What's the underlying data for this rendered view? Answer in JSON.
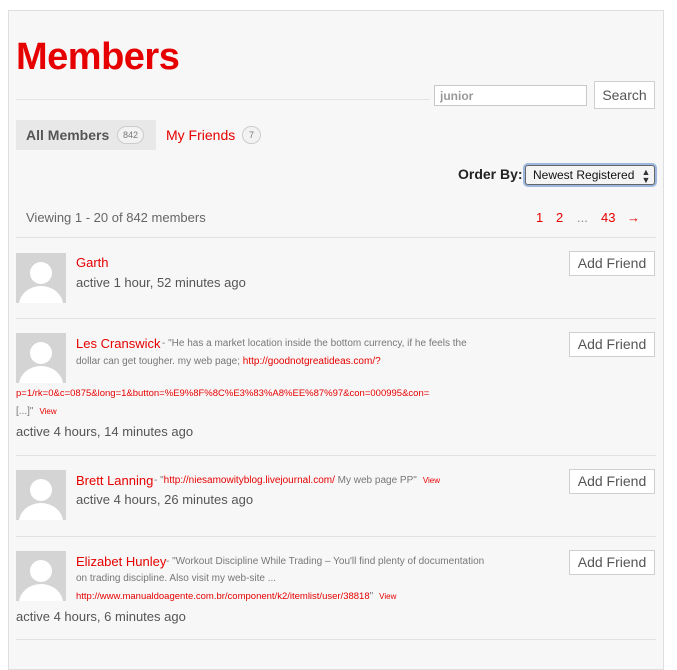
{
  "page": {
    "title": "Members"
  },
  "search": {
    "value": "junior",
    "button_label": "Search"
  },
  "tabs": {
    "all": {
      "label": "All Members",
      "count": "842"
    },
    "friends": {
      "label": "My Friends",
      "count": "7"
    }
  },
  "order": {
    "label": "Order By:",
    "selected": "Newest Registered",
    "arrows": "▲▼"
  },
  "pagination": {
    "viewing": "Viewing 1 - 20 of 842 members",
    "pages": [
      "1",
      "2",
      "...",
      "43",
      "→"
    ]
  },
  "members": [
    {
      "name": "Garth",
      "activity": "active 1 hour, 52 minutes ago",
      "add_friend_label": "Add Friend"
    },
    {
      "name": "Les Cranswick",
      "update_line1_text": " - \"He has a market location inside the bottom currency, if he feels the",
      "update_line2_text": "dollar can get tougher. my web page; ",
      "update_line2_link": "http://goodnotgreatideas.com/?",
      "update_line3_link": "p=1/rk=0&c=0875&long=1&button=%E9%8F%8C%E3%83%A8%EE%87%97&con=000995&con=",
      "update_line4_text": "[...]\"",
      "view_label": "View",
      "activity": "active 4 hours, 14 minutes ago",
      "add_friend_label": "Add Friend"
    },
    {
      "name": "Brett Lanning",
      "update_line1_text_a": " - \"",
      "update_line1_link": "http://niesamowityblog.livejournal.com/",
      "update_line1_text_b": " My web page PP\"",
      "view_label": "View",
      "activity": "active 4 hours, 26 minutes ago",
      "add_friend_label": "Add Friend"
    },
    {
      "name": "Elizabet Hunley",
      "update_line1_text": " - \"Workout Discipline While Trading – You'll find plenty of documentation",
      "update_line2_text": "on trading discipline. Also visit my web-site ...",
      "update_line3_link": "http://www.manualdoagente.com.br/component/k2/itemlist/user/38818",
      "update_line3_tail": "\"",
      "view_label": "View",
      "activity": "active 4 hours, 6 minutes ago",
      "add_friend_label": "Add Friend"
    }
  ]
}
